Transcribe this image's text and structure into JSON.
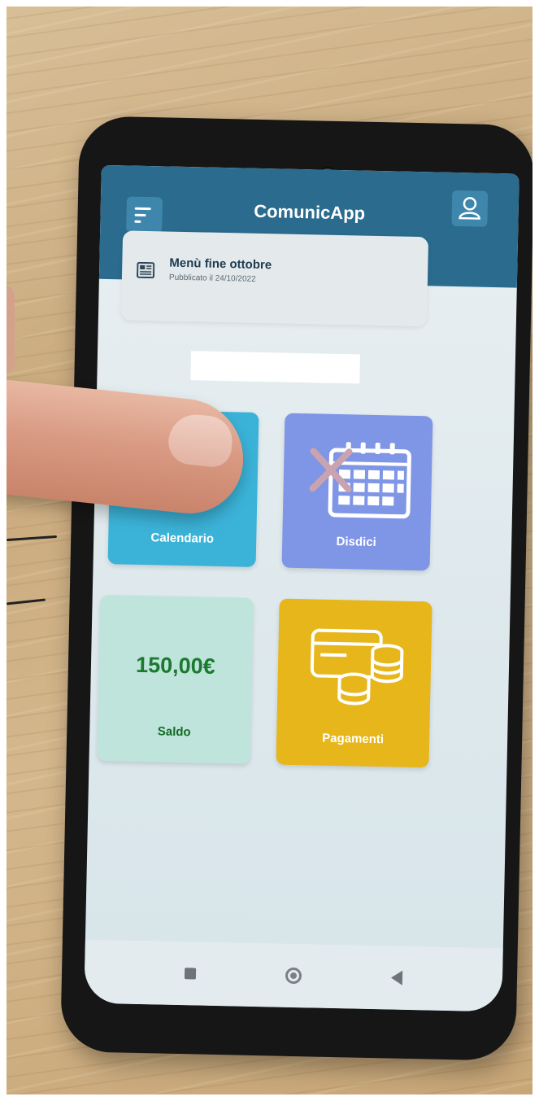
{
  "app": {
    "title": "ComunicApp"
  },
  "header": {
    "menu_icon": "menu-icon",
    "user_icon": "user-icon"
  },
  "notice": {
    "title": "Menù fine ottobre",
    "date": "Pubblicato il 24/10/2022",
    "icon": "newspaper-icon"
  },
  "tiles": {
    "calendar": {
      "label": "Calendario",
      "icon": "calendar-icon"
    },
    "cancel": {
      "label": "Disdici",
      "icon": "calendar-cancel-icon"
    },
    "balance": {
      "label": "Saldo",
      "value": "150,00€"
    },
    "payments": {
      "label": "Pagamenti",
      "icon": "card-coins-icon"
    }
  },
  "navbar": {
    "recents_icon": "square-icon",
    "home_icon": "circle-icon",
    "back_icon": "triangle-back-icon"
  },
  "colors": {
    "header": "#2a6b8e",
    "calendar": "#3bb3d8",
    "cancel": "#7f95e6",
    "balance": "#bfe4dc",
    "payments": "#e6b61b",
    "balance_text": "#1b7a2e"
  }
}
